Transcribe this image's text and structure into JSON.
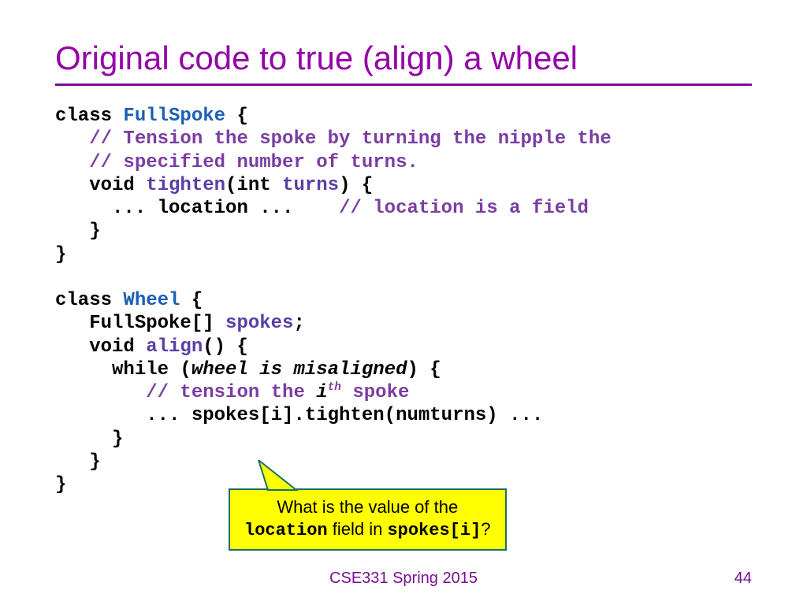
{
  "title": "Original code to true (align) a wheel",
  "code": {
    "c1_kw": "class ",
    "c1_name": "FullSpoke",
    "c1_open": " {",
    "c1_cmt1": "   // Tension the spoke by turning the nipple the",
    "c1_cmt2": "   // specified number of turns.",
    "c1_void": "   void ",
    "c1_fn": "tighten",
    "c1_p1": "(int ",
    "c1_arg": "turns",
    "c1_p2": ") {",
    "c1_body1": "     ... location ...    ",
    "c1_body_cmt": "// location is a field",
    "c1_close1": "   }",
    "c1_close2": "}",
    "c2_kw": "class ",
    "c2_name": "Wheel",
    "c2_open": " {",
    "c2_field1": "   FullSpoke[] ",
    "c2_field_name": "spokes",
    "c2_semi": ";",
    "c2_void": "   void ",
    "c2_fn": "align",
    "c2_paren": "() {",
    "c2_while1": "     while (",
    "c2_cond": "wheel is misaligned",
    "c2_while2": ") {",
    "c2_cmt_pre": "        // tension the ",
    "c2_cmt_i": "i",
    "c2_cmt_th": "th",
    "c2_cmt_post": " spoke",
    "c2_call": "        ... spokes[i].tighten(numturns) ...",
    "c2_close1": "     }",
    "c2_close2": "   }",
    "c2_close3": "}"
  },
  "callout": {
    "line1": "What is the value of the",
    "loc": "location",
    "mid": " field in ",
    "spokes": "spokes[i]",
    "q": "?"
  },
  "footer": "CSE331 Spring 2015",
  "page": "44"
}
